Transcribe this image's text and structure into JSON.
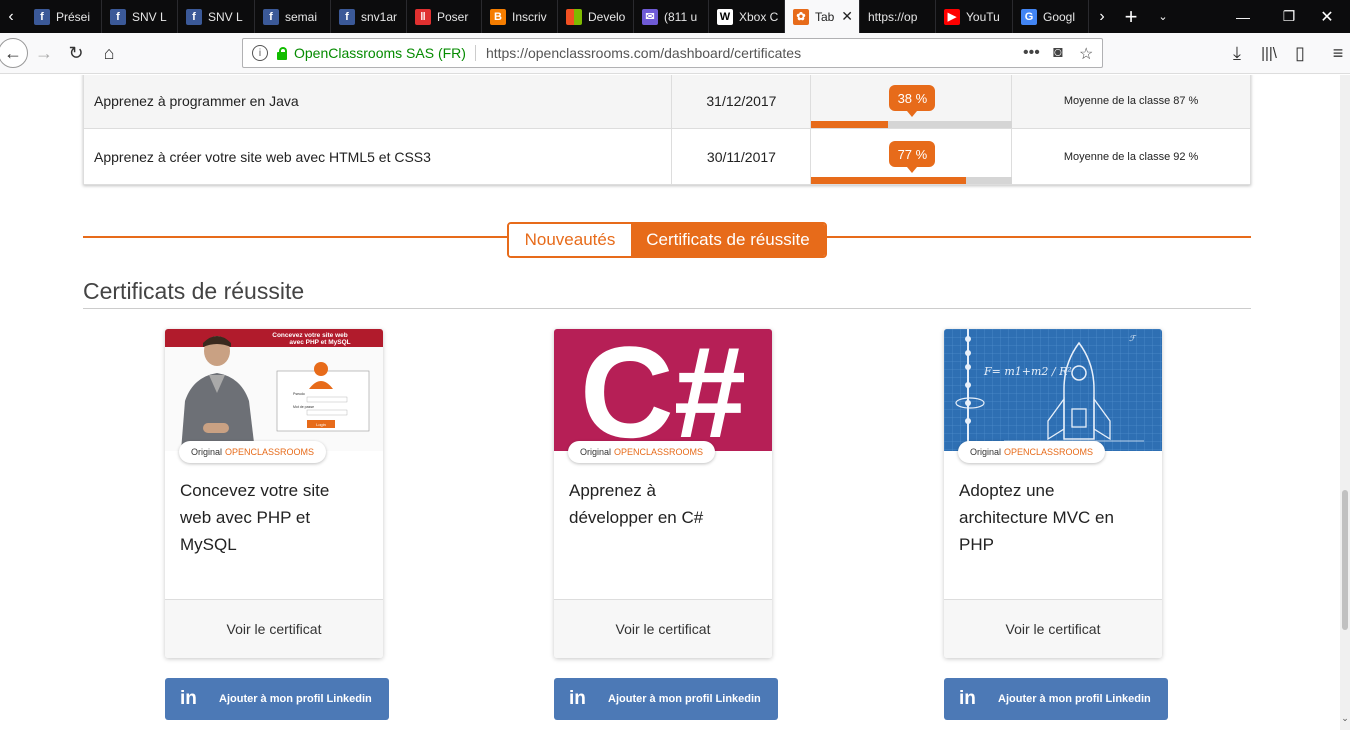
{
  "browser": {
    "tabs": [
      {
        "label": "Prései",
        "icon": "facebook-icon",
        "color": "#3b5998",
        "glyph": "f"
      },
      {
        "label": "SNV L",
        "icon": "facebook-icon",
        "color": "#3b5998",
        "glyph": "f"
      },
      {
        "label": "SNV L",
        "icon": "facebook-icon",
        "color": "#3b5998",
        "glyph": "f"
      },
      {
        "label": "semai",
        "icon": "facebook-icon",
        "color": "#3b5998",
        "glyph": "f"
      },
      {
        "label": "snv1ar",
        "icon": "facebook-icon",
        "color": "#3b5998",
        "glyph": "f"
      },
      {
        "label": "Poser",
        "icon": "pause-icon",
        "color": "#e03030",
        "glyph": "‖"
      },
      {
        "label": "Inscriv",
        "icon": "blogger-icon",
        "color": "#f57d00",
        "glyph": "B"
      },
      {
        "label": "Develo",
        "icon": "microsoft-icon",
        "color": "#7fba00",
        "glyph": ""
      },
      {
        "label": "(811 u",
        "icon": "mail-icon",
        "color": "#6f5bd6",
        "glyph": "✉"
      },
      {
        "label": "Xbox C",
        "icon": "wikipedia-icon",
        "color": "#ffffff",
        "glyph": "W"
      },
      {
        "label": "Tab",
        "icon": "openclassrooms-icon",
        "color": "#e76b1a",
        "glyph": "✿"
      },
      {
        "label": "https://op",
        "icon": "",
        "color": "",
        "glyph": ""
      },
      {
        "label": "YouTu",
        "icon": "youtube-icon",
        "color": "#ff0000",
        "glyph": "▶"
      },
      {
        "label": "Googl",
        "icon": "google-translate-icon",
        "color": "#4285f4",
        "glyph": "G"
      }
    ],
    "url_org": "OpenClassrooms SAS (FR)",
    "url": "https://openclassrooms.com/dashboard/certificates"
  },
  "progress_table": [
    {
      "course": "Apprenez à programmer en Java",
      "date": "31/12/2017",
      "progress_label": "38 %",
      "progress": 38,
      "average": "Moyenne de la classe 87 %"
    },
    {
      "course": "Apprenez à créer votre site web avec HTML5 et CSS3",
      "date": "30/11/2017",
      "progress_label": "77 %",
      "progress": 77,
      "average": "Moyenne de la classe 92 %"
    }
  ],
  "tabs": {
    "news": "Nouveautés",
    "certificates": "Certificats de réussite"
  },
  "section_title": "Certificats de réussite",
  "badge": {
    "prefix": "Original",
    "brand": "OPENCLASSROOMS"
  },
  "certificates": [
    {
      "title": "Concevez votre site web avec PHP et MySQL",
      "image_caption": "Concevez votre site web avec PHP et MySQL",
      "form_labels": [
        "Pseudo",
        "Mot de passe",
        "Login"
      ]
    },
    {
      "title": "Apprenez à développer en C#",
      "image_text": "C#"
    },
    {
      "title": "Adoptez une architecture MVC en PHP",
      "formula": "F= m1+m2 / R²"
    }
  ],
  "card_action": "Voir le certificat",
  "linkedin": {
    "label": "Ajouter à mon profil Linkedin",
    "logo": "in"
  }
}
